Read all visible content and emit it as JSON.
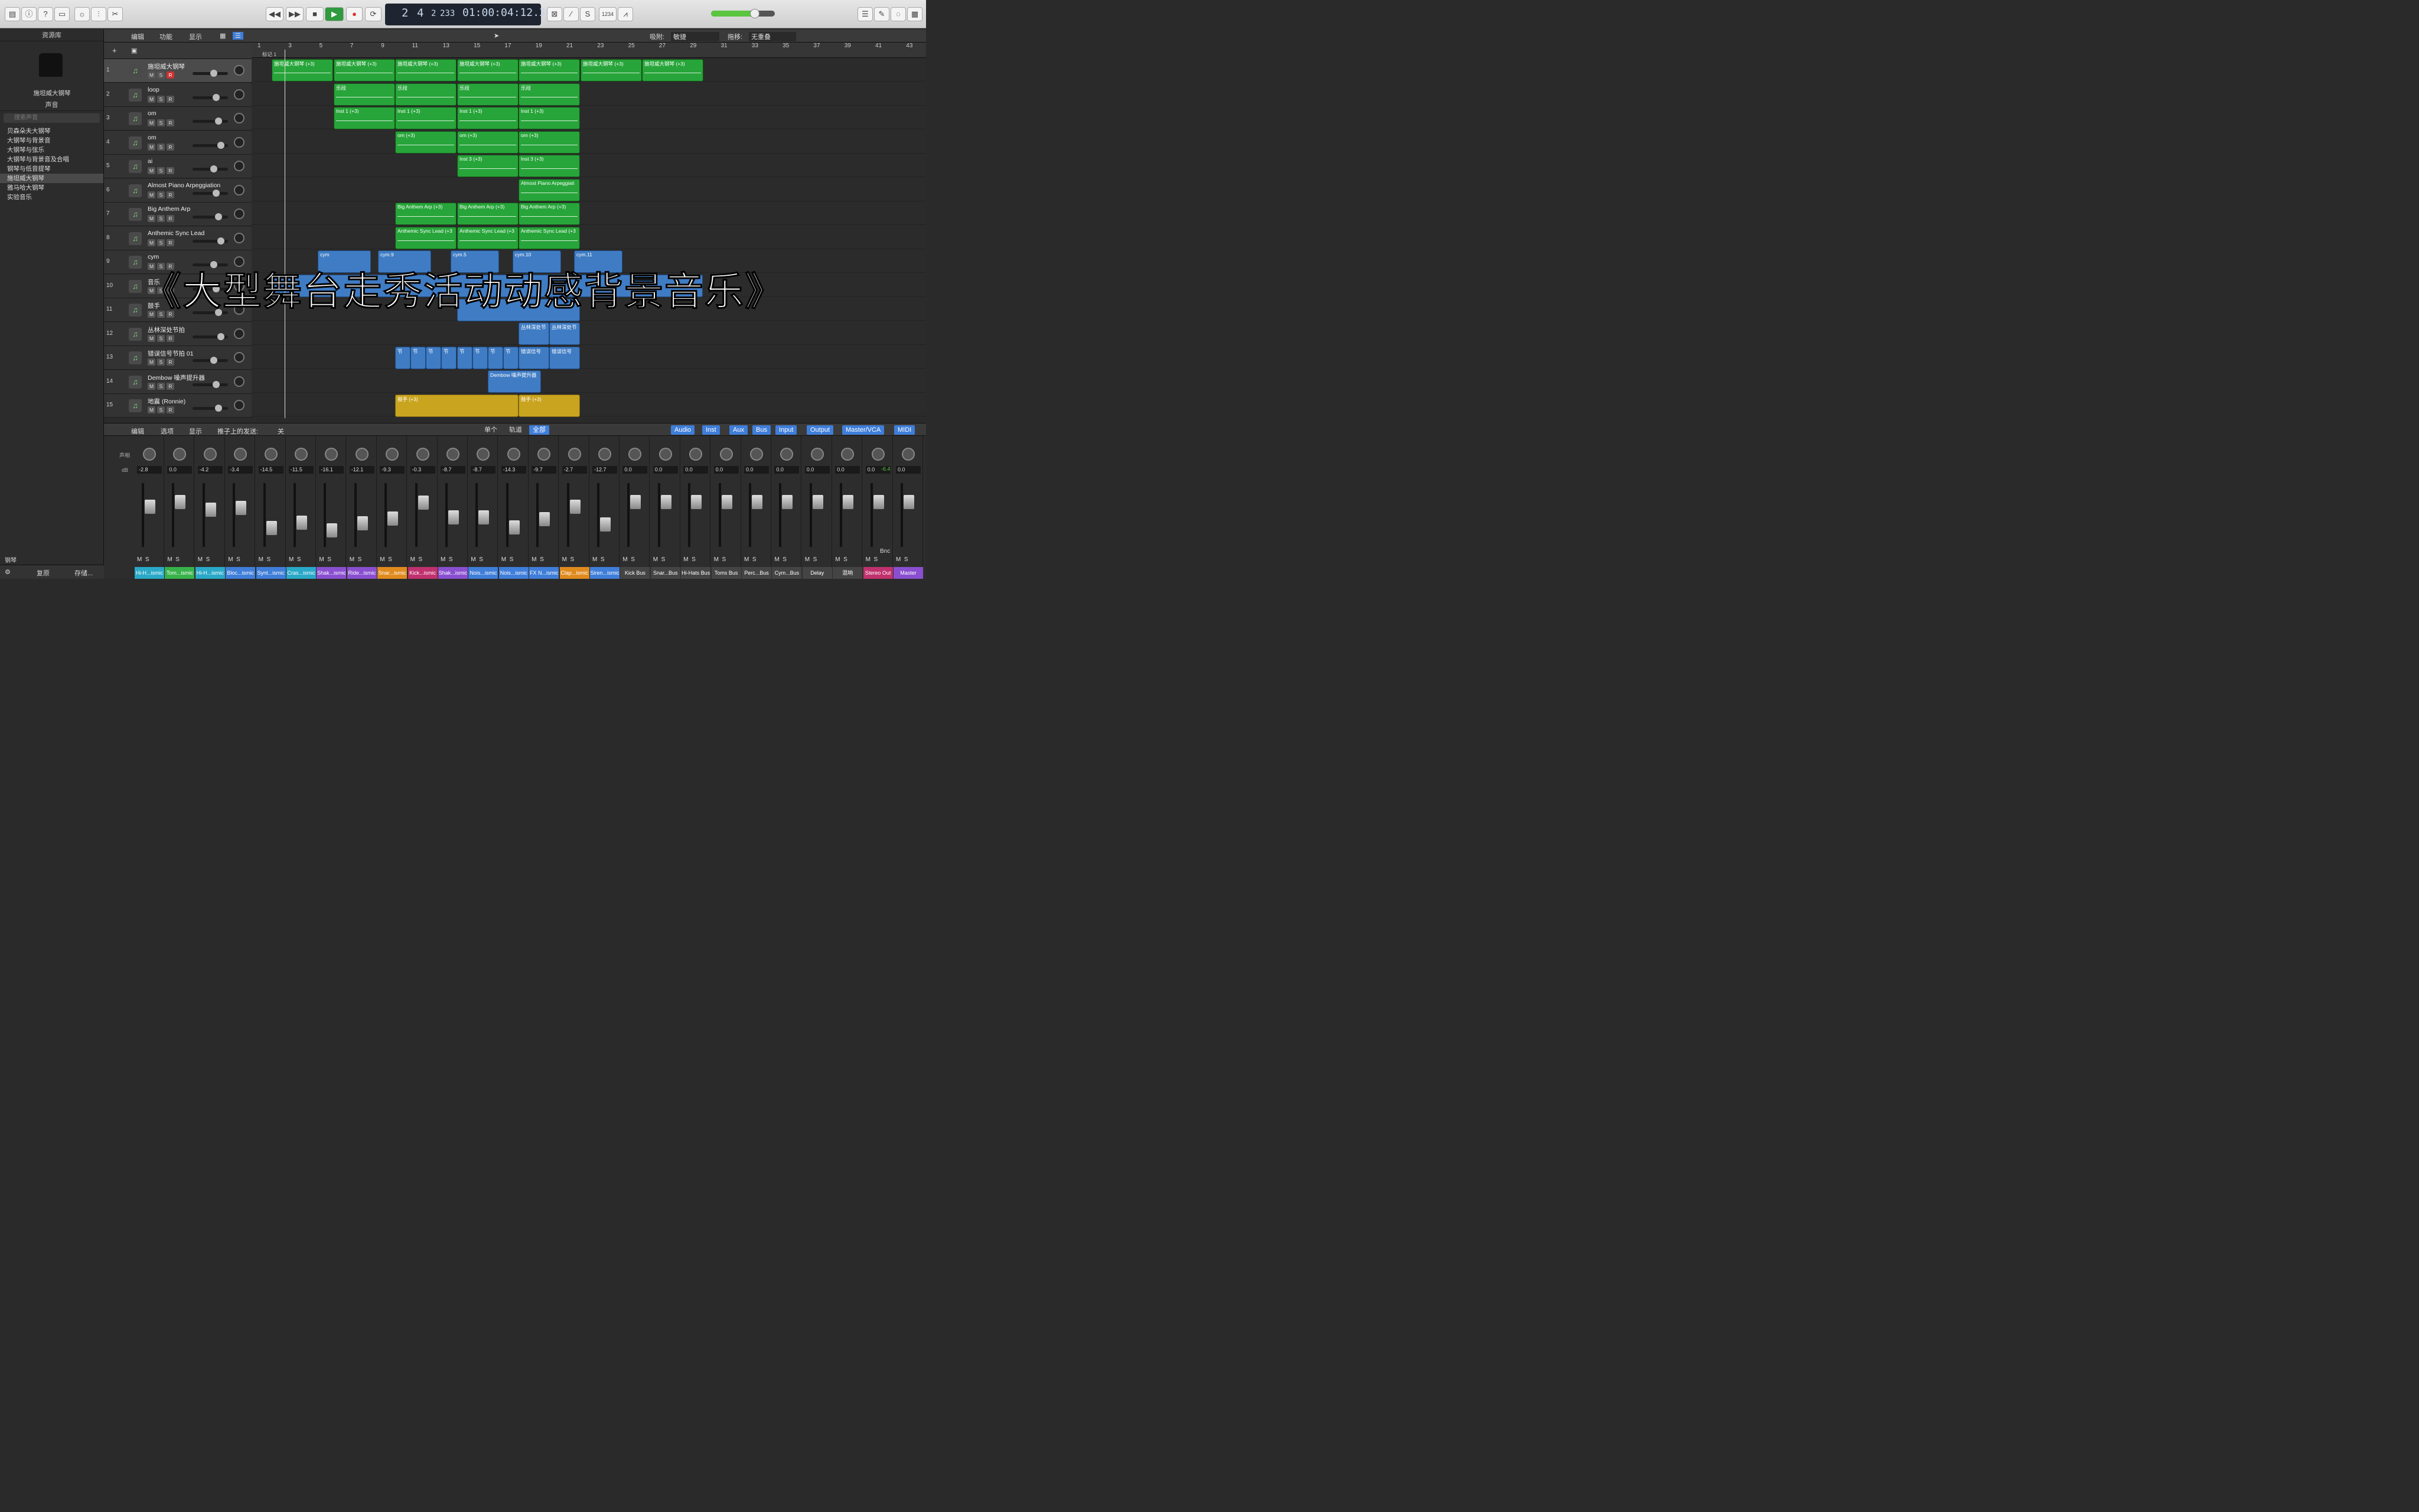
{
  "transport": {
    "bars": "2",
    "beats": "4",
    "div": "2",
    "ticks": "233",
    "time": "01:00:04:12.30",
    "tempo_label": "1234"
  },
  "library": {
    "title": "资源库",
    "patch_name": "施坦威大钢琴",
    "sound_label": "声音",
    "search_placeholder": "搜索声音",
    "items": [
      "贝森朵夫大钢琴",
      "大钢琴与背景音",
      "大钢琴与弦乐",
      "大钢琴与背景音及合唱",
      "钢琴与低音提琴",
      "施坦威大钢琴",
      "雅马哈大钢琴",
      "实验音乐"
    ],
    "footer_category": "钢琴",
    "revert_label": "复原",
    "save_label": "存储..."
  },
  "tracks_bar": {
    "edit": "编辑",
    "functions": "功能",
    "view": "显示",
    "snap_label": "吸附:",
    "snap_value": "敏捷",
    "drag_label": "拖移:",
    "drag_value": "无重叠",
    "marker": "标记 1"
  },
  "ruler": [
    "1",
    "3",
    "5",
    "7",
    "9",
    "11",
    "13",
    "15",
    "17",
    "19",
    "21",
    "23",
    "25",
    "27",
    "29",
    "31",
    "33",
    "35",
    "37",
    "39",
    "41",
    "43"
  ],
  "tracks": [
    {
      "num": "1",
      "name": "施坦威大钢琴",
      "r": true
    },
    {
      "num": "2",
      "name": "loop"
    },
    {
      "num": "3",
      "name": "om"
    },
    {
      "num": "4",
      "name": "om"
    },
    {
      "num": "5",
      "name": "ai"
    },
    {
      "num": "6",
      "name": "Almost Piano Arpeggiation"
    },
    {
      "num": "7",
      "name": "Big Anthem Arp"
    },
    {
      "num": "8",
      "name": "Anthemic Sync Lead"
    },
    {
      "num": "9",
      "name": "cym"
    },
    {
      "num": "10",
      "name": "音乐"
    },
    {
      "num": "11",
      "name": "鼓手"
    },
    {
      "num": "12",
      "name": "丛林深处节拍"
    },
    {
      "num": "13",
      "name": "错误信号节拍 01"
    },
    {
      "num": "14",
      "name": "Dembow 噪声提升器"
    },
    {
      "num": "15",
      "name": "地震 (Ronnie)"
    }
  ],
  "regions": {
    "r1": "施坦威大钢琴 (+3)",
    "r2": "乐段",
    "r3": "Inst 1 (+3)",
    "r4": "om (+3)",
    "r5": "Inst 3 (+3)",
    "r6": "Almost Piano Arpeggiati",
    "r7": "Big Anthem Arp (+3)",
    "r8": "Anthemic Sync Lead (+3",
    "c1": "cym",
    "c2": "cym.9",
    "c3": "cym.5",
    "c4": "cym.10",
    "c5": "cym.11",
    "r12": "丛林深处节",
    "r13": "节",
    "r13b": "错误信号",
    "r14": "Dembow 噪声提升器",
    "r15": "鼓手 (+3)"
  },
  "mixer_bar": {
    "edit": "编辑",
    "options": "选项",
    "view": "显示",
    "sends": "推子上的发送:",
    "sends_value": "关",
    "single": "单个",
    "tracks": "轨道",
    "all": "全部",
    "filters": [
      "Audio",
      "Inst",
      "Aux",
      "Bus",
      "Input",
      "Output",
      "Master/VCA",
      "MIDI"
    ],
    "pan_label": "声相",
    "db_label": "dB"
  },
  "strips": [
    {
      "db": "-2.8",
      "name": "Hi-H...ismic",
      "color": "#2aa8c8"
    },
    {
      "db": "0.0",
      "name": "Tom...ismic",
      "color": "#38b24a"
    },
    {
      "db": "-4.2",
      "name": "Hi-H...ismic",
      "color": "#2aa8c8"
    },
    {
      "db": "-3.4",
      "name": "Bloc...ismic",
      "color": "#3f7ed9"
    },
    {
      "db": "-14.5",
      "name": "Synt...ismic",
      "color": "#3f7ed9"
    },
    {
      "db": "-11.5",
      "name": "Cras...ismic",
      "color": "#2aa8c8"
    },
    {
      "db": "-16.1",
      "name": "Shak...ismic",
      "color": "#8a4fd0"
    },
    {
      "db": "-12.1",
      "name": "Ride...ismic",
      "color": "#8a4fd0"
    },
    {
      "db": "-9.3",
      "name": "Snar...ismic",
      "color": "#e08a1e"
    },
    {
      "db": "-0.3",
      "name": "Kick...ismic",
      "color": "#c0316e"
    },
    {
      "db": "-8.7",
      "name": "Shak...ismic",
      "color": "#8a4fd0"
    },
    {
      "db": "-8.7",
      "name": "Nois...ismic",
      "color": "#3f7ed9"
    },
    {
      "db": "-14.3",
      "name": "Nois...ismic",
      "color": "#3f7ed9"
    },
    {
      "db": "-9.7",
      "name": "FX N...ismic",
      "color": "#3f7ed9"
    },
    {
      "db": "-2.7",
      "name": "Clap...ismic",
      "color": "#e08a1e"
    },
    {
      "db": "-12.7",
      "name": "Siren...ismic",
      "color": "#3f7ed9"
    },
    {
      "db": "0.0",
      "name": "Kick Bus",
      "color": "#444"
    },
    {
      "db": "0.0",
      "name": "Snar...Bus",
      "color": "#444"
    },
    {
      "db": "0.0",
      "name": "Hi-Hats Bus",
      "color": "#444"
    },
    {
      "db": "0.0",
      "name": "Toms Bus",
      "color": "#444"
    },
    {
      "db": "0.0",
      "name": "Perc...Bus",
      "color": "#444"
    },
    {
      "db": "0.0",
      "name": "Cym...Bus",
      "color": "#444"
    },
    {
      "db": "0.0",
      "name": "Delay",
      "color": "#444"
    },
    {
      "db": "0.0",
      "name": "混响",
      "color": "#444"
    },
    {
      "db": "0.0",
      "name": "Stereo Out",
      "color": "#c0316e"
    },
    {
      "db": "0.0",
      "name": "Master",
      "color": "#8a4fd0"
    }
  ],
  "stereo_peak": "-6.4",
  "bounce_label": "Bnc",
  "overlay_title": "《大型舞台走秀活动动感背景音乐》"
}
